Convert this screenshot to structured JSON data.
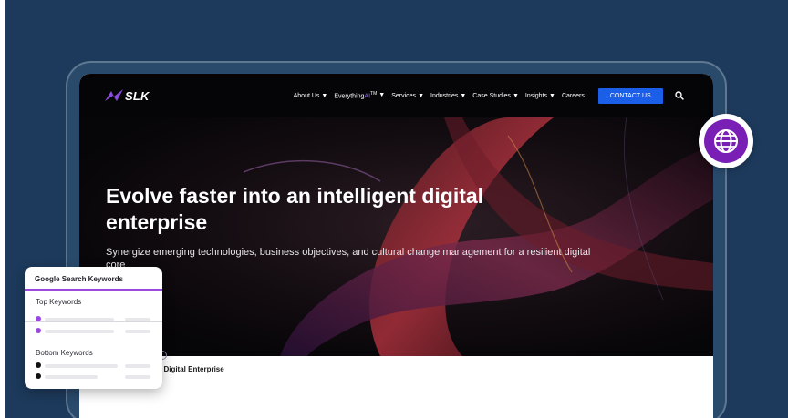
{
  "brand": {
    "logo_text": "SLK",
    "logo_color": "#8b4dd9"
  },
  "nav": {
    "items": [
      {
        "label": "About Us",
        "has_caret": true
      },
      {
        "label": "Everything",
        "ai_suffix": "AI",
        "tm": "TM",
        "has_caret": true
      },
      {
        "label": "Services",
        "has_caret": true
      },
      {
        "label": "Industries",
        "has_caret": true
      },
      {
        "label": "Case Studies",
        "has_caret": true
      },
      {
        "label": "Insights",
        "has_caret": true
      },
      {
        "label": "Careers",
        "has_caret": false
      }
    ],
    "contact_label": "CONTACT US",
    "contact_color": "#1b5fe8"
  },
  "hero": {
    "title": "Evolve faster into an intelligent digital enterprise",
    "subtitle": "Synergize emerging technologies, business objectives, and cultural change management for a resilient digital core"
  },
  "breadcrumb": {
    "current": "/ Digital Enterprise"
  },
  "keyword_card": {
    "title": "Google Search Keywords",
    "top_label": "Top Keywords",
    "bottom_label": "Bottom Keywords",
    "accent_color": "#9b47e0"
  },
  "badge": {
    "icon": "globe-icon",
    "color": "#7a1fb5"
  }
}
